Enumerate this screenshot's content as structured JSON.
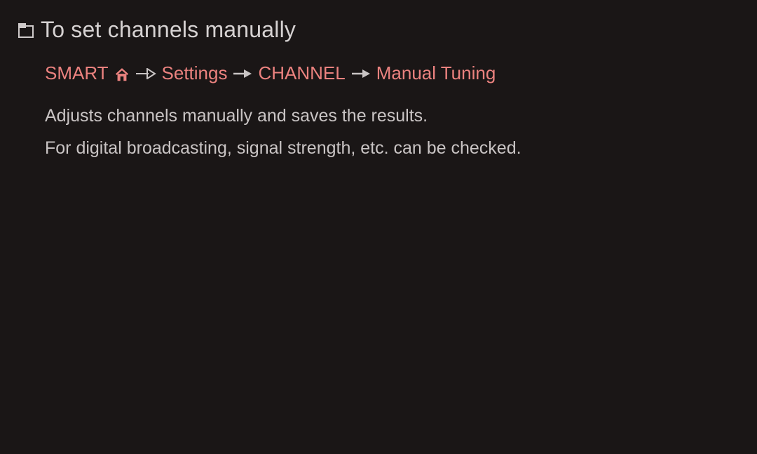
{
  "title": "To set channels manually",
  "breadcrumb": {
    "items": [
      {
        "label": "SMART",
        "hasHomeIcon": true,
        "arrowAfter": "open"
      },
      {
        "label": "Settings",
        "arrowAfter": "solid"
      },
      {
        "label": "CHANNEL",
        "arrowAfter": "solid"
      },
      {
        "label": "Manual Tuning"
      }
    ]
  },
  "body": {
    "line1": "Adjusts channels manually and saves the results.",
    "line2": "For digital broadcasting, signal strength, etc. can be checked."
  },
  "colors": {
    "background": "#1a1616",
    "textPrimary": "#d6d2d2",
    "textBody": "#c9c4c4",
    "accent": "#eb827f"
  }
}
